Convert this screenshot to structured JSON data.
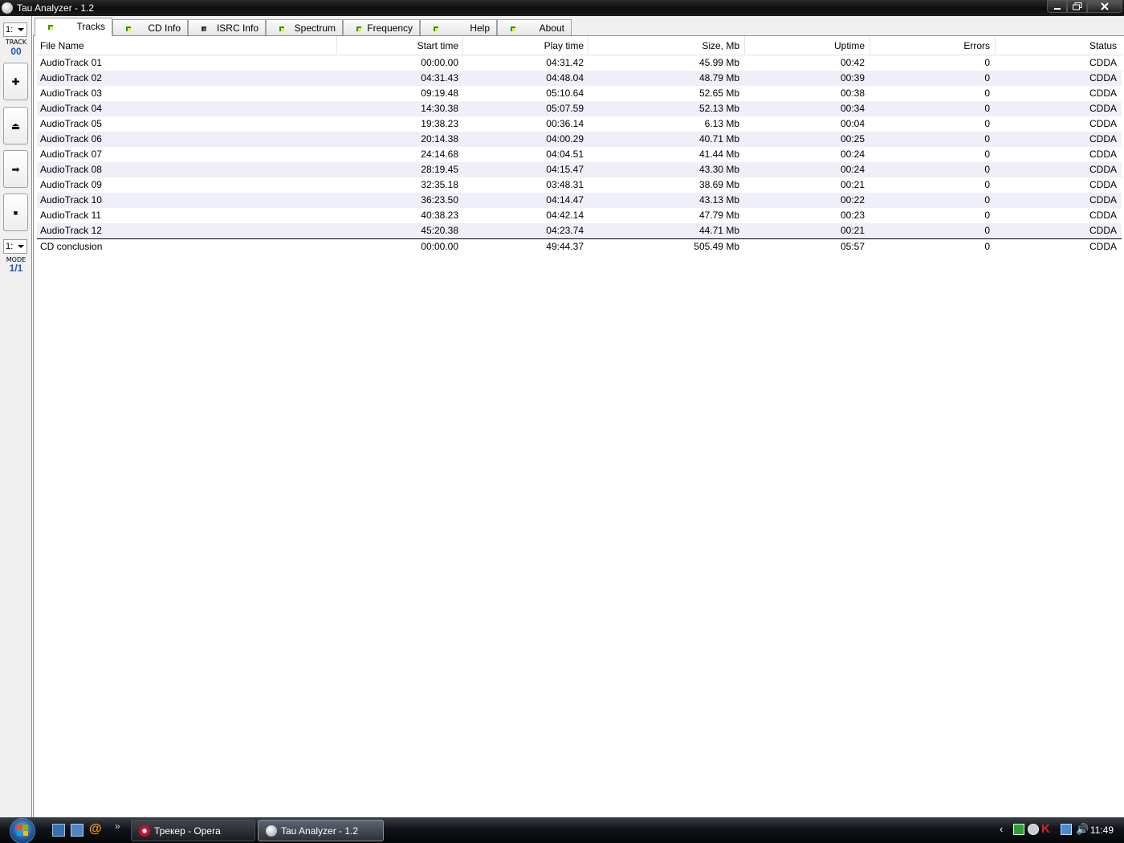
{
  "window": {
    "title": "Tau Analyzer - 1.2"
  },
  "leftbar": {
    "track_combo": "1:",
    "track_label": "TRACK",
    "track_value": "00",
    "mode_combo": "1:",
    "mode_label": "MODE",
    "mode_value": "1/1",
    "buttons": [
      {
        "icon": "plus-icon",
        "glyph": "✚"
      },
      {
        "icon": "eject-icon",
        "glyph": "⏏"
      },
      {
        "icon": "arrow-right-icon",
        "glyph": "➡"
      },
      {
        "icon": "stop-icon",
        "glyph": "■"
      }
    ]
  },
  "tabs": [
    {
      "label": "Tracks",
      "active": true
    },
    {
      "label": "CD Info",
      "active": false
    },
    {
      "label": "ISRC Info",
      "active": false
    },
    {
      "label": "Spectrum",
      "active": false
    },
    {
      "label": "Frequency",
      "active": false
    },
    {
      "label": "Help",
      "active": false
    },
    {
      "label": "About",
      "active": false
    }
  ],
  "table": {
    "columns": [
      "File Name",
      "Start time",
      "Play time",
      "Size, Mb",
      "Uptime",
      "Errors",
      "Status"
    ],
    "rows": [
      [
        "AudioTrack 01",
        "00:00.00",
        "04:31.42",
        "45.99 Mb",
        "00:42",
        "0",
        "CDDA"
      ],
      [
        "AudioTrack 02",
        "04:31.43",
        "04:48.04",
        "48.79 Mb",
        "00:39",
        "0",
        "CDDA"
      ],
      [
        "AudioTrack 03",
        "09:19.48",
        "05:10.64",
        "52.65 Mb",
        "00:38",
        "0",
        "CDDA"
      ],
      [
        "AudioTrack 04",
        "14:30.38",
        "05:07.59",
        "52.13 Mb",
        "00:34",
        "0",
        "CDDA"
      ],
      [
        "AudioTrack 05",
        "19:38.23",
        "00:36.14",
        "6.13 Mb",
        "00:04",
        "0",
        "CDDA"
      ],
      [
        "AudioTrack 06",
        "20:14.38",
        "04:00.29",
        "40.71 Mb",
        "00:25",
        "0",
        "CDDA"
      ],
      [
        "AudioTrack 07",
        "24:14.68",
        "04:04.51",
        "41.44 Mb",
        "00:24",
        "0",
        "CDDA"
      ],
      [
        "AudioTrack 08",
        "28:19.45",
        "04:15.47",
        "43.30 Mb",
        "00:24",
        "0",
        "CDDA"
      ],
      [
        "AudioTrack 09",
        "32:35.18",
        "03:48.31",
        "38.69 Mb",
        "00:21",
        "0",
        "CDDA"
      ],
      [
        "AudioTrack 10",
        "36:23.50",
        "04:14.47",
        "43.13 Mb",
        "00:22",
        "0",
        "CDDA"
      ],
      [
        "AudioTrack 11",
        "40:38.23",
        "04:42.14",
        "47.79 Mb",
        "00:23",
        "0",
        "CDDA"
      ],
      [
        "AudioTrack 12",
        "45:20.38",
        "04:23.74",
        "44.71 Mb",
        "00:21",
        "0",
        "CDDA"
      ]
    ],
    "total": [
      "CD conclusion",
      "00:00.00",
      "49:44.37",
      "505.49 Mb",
      "05:57",
      "0",
      "CDDA"
    ]
  },
  "taskbar": {
    "items": [
      {
        "label": "Трекер - Opera",
        "icon": "opera-icon",
        "active": false
      },
      {
        "label": "Tau Analyzer - 1.2",
        "icon": "tau-analyzer-icon",
        "active": true
      }
    ],
    "clock": "11:49",
    "overflow": "»"
  }
}
